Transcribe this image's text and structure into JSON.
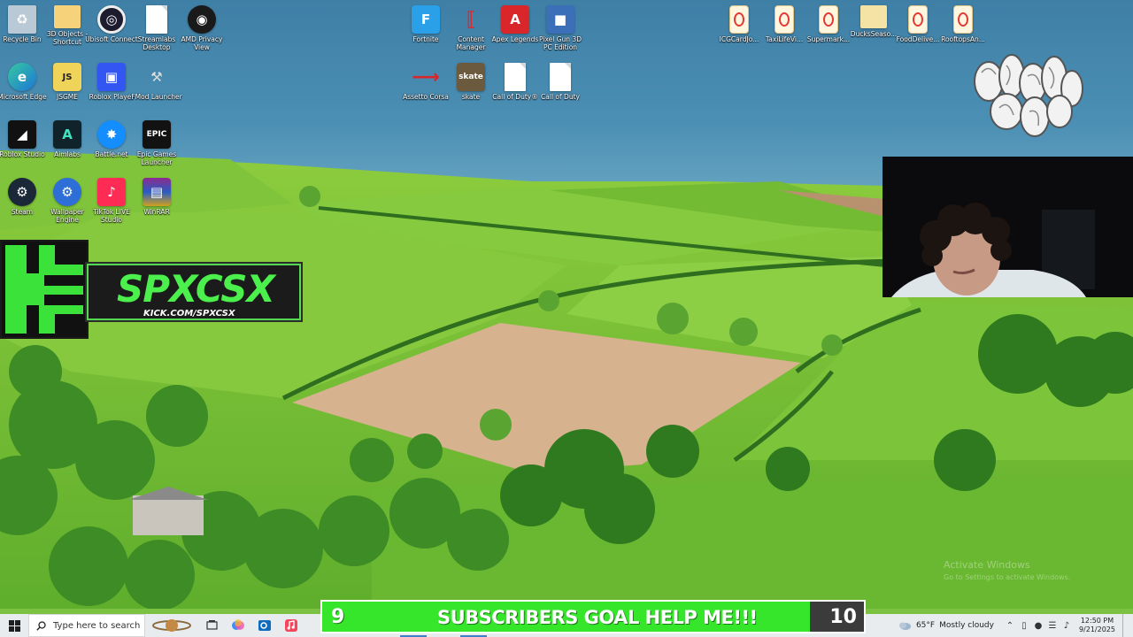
{
  "desktop": {
    "icons": [
      {
        "label": "Recycle Bin",
        "icon": "recycle-bin-icon"
      },
      {
        "label": "3D Objects - Shortcut",
        "icon": "folder-shortcut-icon"
      },
      {
        "label": "Ubisoft Connect",
        "icon": "ubisoft-icon"
      },
      {
        "label": "Streamlabs Desktop",
        "icon": "file-icon"
      },
      {
        "label": "AMD Privacy View",
        "icon": "amd-privacy-icon"
      },
      {
        "label": "Microsoft Edge",
        "icon": "edge-icon"
      },
      {
        "label": "JSGME",
        "icon": "jsgme-icon"
      },
      {
        "label": "Roblox Player",
        "icon": "roblox-player-icon"
      },
      {
        "label": "FMod Launcher",
        "icon": "fmod-icon"
      },
      {
        "label": "Roblox Studio",
        "icon": "roblox-studio-icon"
      },
      {
        "label": "Aimlabs",
        "icon": "aimlabs-icon"
      },
      {
        "label": "Battle.net",
        "icon": "battlenet-icon"
      },
      {
        "label": "Epic Games Launcher",
        "icon": "epic-games-icon"
      },
      {
        "label": "Steam",
        "icon": "steam-icon"
      },
      {
        "label": "Wallpaper Engine",
        "icon": "wallpaper-engine-icon"
      },
      {
        "label": "TikTok LIVE Studio",
        "icon": "tiktok-icon"
      },
      {
        "label": "WinRAR",
        "icon": "winrar-icon"
      },
      {
        "label": "Fortnite",
        "icon": "fortnite-icon"
      },
      {
        "label": "Content Manager",
        "icon": "content-manager-icon"
      },
      {
        "label": "Apex Legends",
        "icon": "apex-icon"
      },
      {
        "label": "Pixel Gun 3D PC Edition",
        "icon": "pixel-gun-icon"
      },
      {
        "label": "Assetto Corsa",
        "icon": "assetto-corsa-icon"
      },
      {
        "label": "skate",
        "icon": "skate-icon"
      },
      {
        "label": "Call of Duty®",
        "icon": "file-icon"
      },
      {
        "label": "Call of Duty",
        "icon": "file-icon"
      },
      {
        "label": "ICGCardJo...",
        "icon": "pdf-icon"
      },
      {
        "label": "TaxiLifeVi...",
        "icon": "pdf-icon"
      },
      {
        "label": "Supermark...",
        "icon": "pdf-icon"
      },
      {
        "label": "DucksSeaso...",
        "icon": "folder-icon"
      },
      {
        "label": "FoodDelive...",
        "icon": "pdf-icon"
      },
      {
        "label": "RooftopsAn...",
        "icon": "pdf-icon"
      }
    ]
  },
  "overlay": {
    "kick_name": "SPXCSX",
    "kick_url": "KICK.COM/SPXCSX",
    "graffiti_text": "SPXCSX"
  },
  "subscriber_goal": {
    "current": "9",
    "title": "SUBSCRIBERS GOAL HELP ME!!!",
    "target": "10",
    "progress_fraction": 0.9
  },
  "watermark": {
    "line1": "Activate Windows",
    "line2": "Go to Settings to activate Windows."
  },
  "taskbar": {
    "search_placeholder": "Type here to search",
    "weather_temp": "65°F",
    "weather_text": "Mostly cloudy",
    "time": "12:50 PM",
    "date": "9/21/2025",
    "pinned": [
      "saturn-icon",
      "task-view-icon",
      "copilot-icon",
      "outlook-icon",
      "itunes-icon"
    ]
  },
  "colors": {
    "kick_green": "#53fc18",
    "goal_green": "#35e62b",
    "taskbar": "#e8ecef"
  }
}
